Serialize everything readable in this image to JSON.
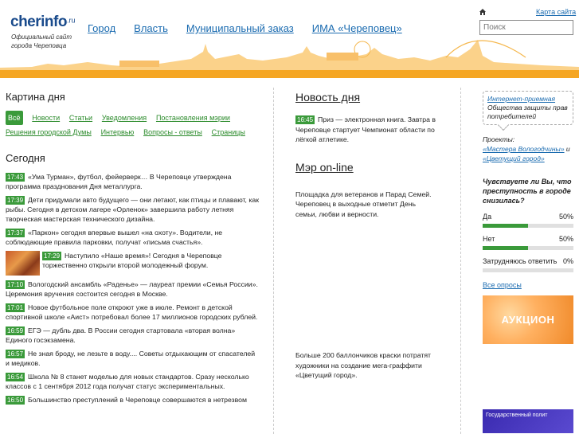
{
  "header": {
    "logo": "cherinfo",
    "logo_tld": ".ru",
    "logo_subtitle": "Официальный сайт города Череповца",
    "nav": [
      "Город",
      "Власть",
      "Муниципальный заказ",
      "ИМА «Череповец»"
    ],
    "map_link": "Карта сайта",
    "search_placeholder": "Поиск"
  },
  "left": {
    "picture_title": "Картина дня",
    "tags": [
      "Всё",
      "Новости",
      "Статьи",
      "Уведомления",
      "Постановления мэрии",
      "Решения городской Думы",
      "Интервью",
      "Вопросы - ответы",
      "Страницы"
    ],
    "today_title": "Сегодня",
    "news": [
      {
        "time": "17:43",
        "text": "«Ума Турман», футбол, фейерверк… В Череповце утверждена программа празднования Дня металлурга."
      },
      {
        "time": "17:39",
        "text": "Дети придумали авто будущего — они летают, как птицы и плавают, как рыбы. Сегодня в детском лагере «Орленок» завершила работу летняя творческая мастерская технического дизайна."
      },
      {
        "time": "17:37",
        "text": "«Паркон» сегодня впервые вышел «на охоту». Водители, не соблюдающие правила парковки, получат «письма счастья»."
      },
      {
        "time": "17:29",
        "text": "Наступило «Наше время»! Сегодня в Череповце торжественно открыли второй молодежный форум."
      },
      {
        "time": "17:10",
        "text": "Вологодский ансамбль «Раденье» — лауреат премии «Семья России». Церемония вручения состоится сегодня  в Москве."
      },
      {
        "time": "17:01",
        "text": "Новое футбольное поле откроют уже в июле. Ремонт в детской спортивной школе «Аист» потребовал более 17 миллионов городских рублей."
      },
      {
        "time": "16:59",
        "text": "ЕГЭ — дубль два. В России сегодня стартовала «вторая волна» Единого госэкзамена."
      },
      {
        "time": "16:57",
        "text": "Не зная броду, не лезьте в воду.... Советы отдыхающим от спасателей и медиков."
      },
      {
        "time": "16:54",
        "text": "Школа № 8 станет моделью для новых стандартов. Сразу несколько классов с 1 сентября 2012 года получат статус экспериментальных."
      },
      {
        "time": "16:50",
        "text": "Большинство преступлений в Череповце совершаются в нетрезвом"
      }
    ]
  },
  "middle": {
    "news_of_day_title": "Новость дня",
    "news_of_day": {
      "time": "16:45",
      "text": "Приз — электронная книга. Завтра в Череповце стартует Чемпионат области по лёгкой атлетике."
    },
    "mayor_title": "Мэр on-line",
    "mayor_text": "Площадка для ветеранов и Парад Семей. Череповец в выходные отметит День семьи, любви и верности.",
    "bottom_text": "Больше 200 баллончиков краски потратят художники на создание мега-граффити «Цветущий город»."
  },
  "right": {
    "bubble_link": "Интернет-приемная",
    "bubble_text": "Общества защиты прав потребителей",
    "projects_label": "Проекты:",
    "project1": "«Мастера Вологодчины»",
    "projects_and": "и",
    "project2": "«Цветущий город»",
    "poll_question": "Чувствуете ли Вы, что преступность в городе снизилась?",
    "poll_options": [
      {
        "label": "Да",
        "pct": "50%",
        "value": 50
      },
      {
        "label": "Нет",
        "pct": "50%",
        "value": 50
      },
      {
        "label": "Затрудняюсь ответить",
        "pct": "0%",
        "value": 0
      }
    ],
    "all_polls": "Все опросы",
    "banner_text": "АУКЦИОН",
    "banner2_text": "Государственный полит"
  },
  "colors": {
    "accent_green": "#3a9a3a",
    "link_blue": "#1a6bb0",
    "skyline_orange": "#f5a623"
  }
}
